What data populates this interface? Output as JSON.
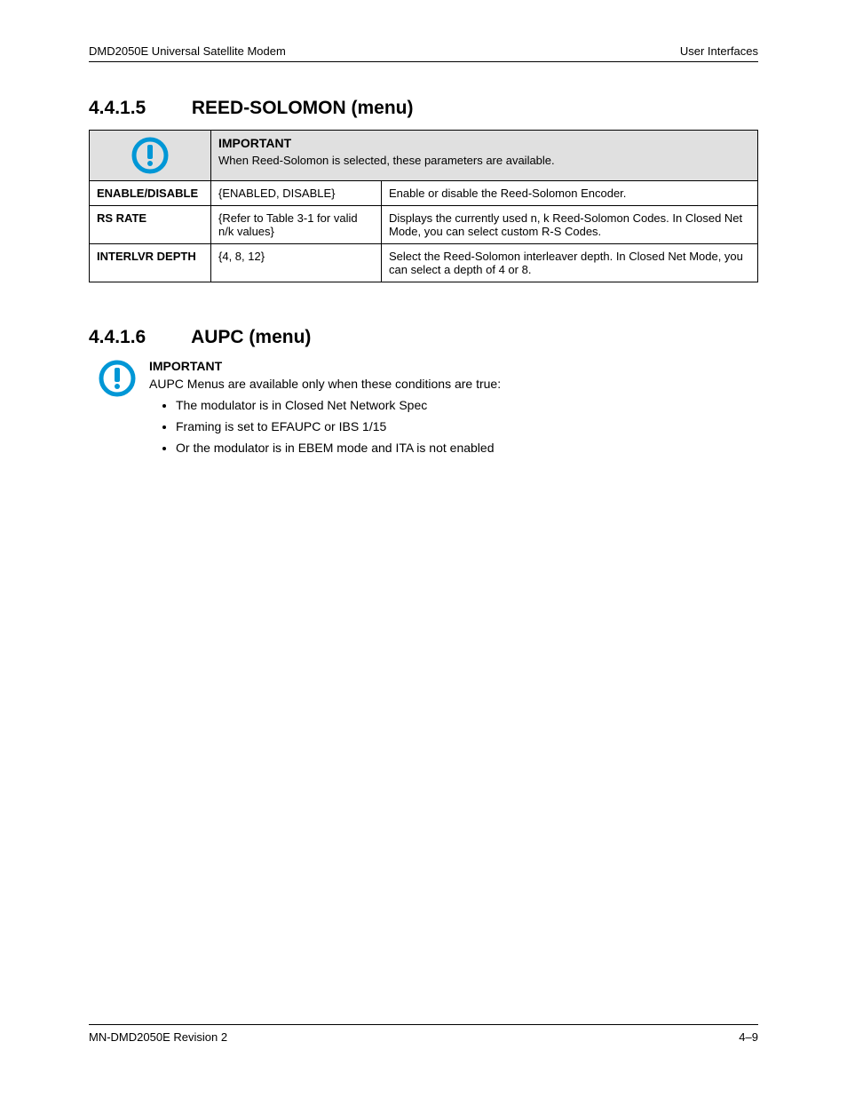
{
  "header": {
    "left": "DMD2050E Universal Satellite Modem",
    "right": "User Interfaces"
  },
  "section1": {
    "number": "4.4.1.5",
    "title": "REED-SOLOMON (menu)",
    "important": {
      "label": "IMPORTANT",
      "text": "When Reed-Solomon is selected, these parameters are available."
    },
    "rows": [
      {
        "name": "ENABLE/DISABLE",
        "value": "{ENABLED, DISABLE}",
        "desc": "Enable or disable the Reed-Solomon Encoder."
      },
      {
        "name": "RS RATE",
        "value": "{Refer to Table 3-1 for valid n/k values}",
        "desc": "Displays the currently used n, k Reed-Solomon Codes.  In Closed Net Mode, you can select custom R-S Codes."
      },
      {
        "name": "INTERLVR DEPTH",
        "value": "{4, 8, 12}",
        "desc": "Select the Reed-Solomon interleaver depth.  In Closed Net Mode, you can select a depth of 4 or 8."
      }
    ]
  },
  "section2": {
    "number": "4.4.1.6",
    "title": "AUPC (menu)",
    "important": {
      "label": "IMPORTANT",
      "text": "AUPC Menus are available only when these conditions are true:"
    },
    "conditions": [
      "The modulator is in Closed Net Network Spec",
      "Framing is set to EFAUPC or IBS 1/15",
      "Or the modulator is in EBEM mode and ITA is not enabled"
    ]
  },
  "footer": {
    "left": "MN-DMD2050E   Revision 2",
    "right": "4–9"
  }
}
